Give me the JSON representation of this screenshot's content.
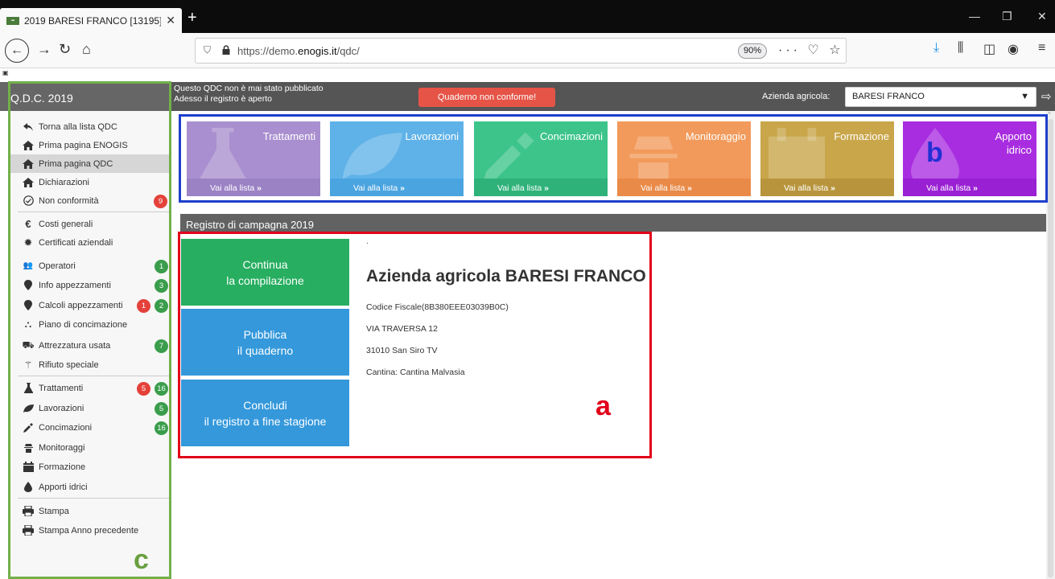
{
  "browser": {
    "tab_title": "2019 BARESI FRANCO [13195] -",
    "new_tab": "+",
    "url_prefix": "https://demo.",
    "url_domain": "enogis.it",
    "url_suffix": "/qdc/",
    "zoom": "90%"
  },
  "header": {
    "app_title": "Q.D.C. 2019",
    "message_line1": "Questo QDC non è mai stato pubblicato",
    "message_line2": "Adesso il registro è aperto",
    "warning_badge": "Quaderno non conforme!",
    "company_label": "Azienda agricola:",
    "company_selected": "BARESI FRANCO"
  },
  "sidebar": {
    "items": [
      {
        "label": "Torna alla lista QDC",
        "icon": "back-arrow-icon"
      },
      {
        "label": "Prima pagina ENOGIS",
        "icon": "home-icon"
      },
      {
        "label": "Prima pagina QDC",
        "icon": "home-icon"
      },
      {
        "label": "Dichiarazioni",
        "icon": "home-icon"
      },
      {
        "label": "Non conformità",
        "icon": "check-circle-icon",
        "badge_red": "9"
      },
      {
        "label": "Costi generali",
        "icon": "euro-icon"
      },
      {
        "label": "Certificati aziendali",
        "icon": "certificate-icon"
      },
      {
        "label": "Operatori",
        "icon": "users-icon",
        "badge_green": "1"
      },
      {
        "label": "Info appezzamenti",
        "icon": "map-marker-icon",
        "badge_green": "3"
      },
      {
        "label": "Calcoli appezzamenti",
        "icon": "map-marker-icon",
        "badge_red": "1",
        "badge_green": "2"
      },
      {
        "label": "Piano di concimazione",
        "icon": "binoculars-icon"
      },
      {
        "label": "Attrezzatura usata",
        "icon": "tractor-icon",
        "badge_green": "7"
      },
      {
        "label": "Rifiuto speciale",
        "icon": "wand-icon"
      },
      {
        "label": "Trattamenti",
        "icon": "flask-icon",
        "badge_red": "5",
        "badge_green": "16"
      },
      {
        "label": "Lavorazioni",
        "icon": "leaf-icon",
        "badge_green": "5"
      },
      {
        "label": "Concimazioni",
        "icon": "dropper-icon",
        "badge_green": "16"
      },
      {
        "label": "Monitoraggi",
        "icon": "spy-icon"
      },
      {
        "label": "Formazione",
        "icon": "calendar-icon"
      },
      {
        "label": "Apporti idrici",
        "icon": "drop-icon"
      },
      {
        "label": "Stampa",
        "icon": "print-icon"
      },
      {
        "label": "Stampa Anno precedente",
        "icon": "print-icon"
      }
    ]
  },
  "tiles": [
    {
      "title": "Trattamenti",
      "footer": "Vai alla lista",
      "color": "#a98fcf",
      "footer_color": "#9b82c4"
    },
    {
      "title": "Lavorazioni",
      "footer": "Vai alla lista",
      "color": "#5fb2e8",
      "footer_color": "#4aa4e0"
    },
    {
      "title": "Concimazioni",
      "footer": "Vai alla lista",
      "color": "#3cc48a",
      "footer_color": "#2fb27a"
    },
    {
      "title": "Monitoraggio",
      "footer": "Vai alla lista",
      "color": "#f29a5b",
      "footer_color": "#e98a48"
    },
    {
      "title": "Formazione",
      "footer": "Vai alla lista",
      "color": "#c9a64a",
      "footer_color": "#b8953d"
    },
    {
      "title_line1": "Apporto",
      "title_line2": "idrico",
      "footer": "Vai alla lista",
      "color": "#a82de0",
      "footer_color": "#9a20d3"
    }
  ],
  "register": {
    "header": "Registro di campagna 2019",
    "btn_continue_1": "Continua",
    "btn_continue_2": "la compilazione",
    "btn_publish_1": "Pubblica",
    "btn_publish_2": "il quaderno",
    "btn_conclude_1": "Concludi",
    "btn_conclude_2": "il registro a fine stagione",
    "company_title": "Azienda agricola BARESI FRANCO",
    "fiscal_code": "Codice Fiscale(8B380EEE03039B0C)",
    "address": "VIA TRAVERSA 12",
    "city": "31010 San Siro TV",
    "cantina": "Cantina: Cantina Malvasia"
  },
  "annotations": {
    "a": "a",
    "b": "b",
    "c": "c"
  },
  "colors": {
    "green_button": "#27ae60",
    "blue_button": "#3498db",
    "warning": "#e55447"
  }
}
